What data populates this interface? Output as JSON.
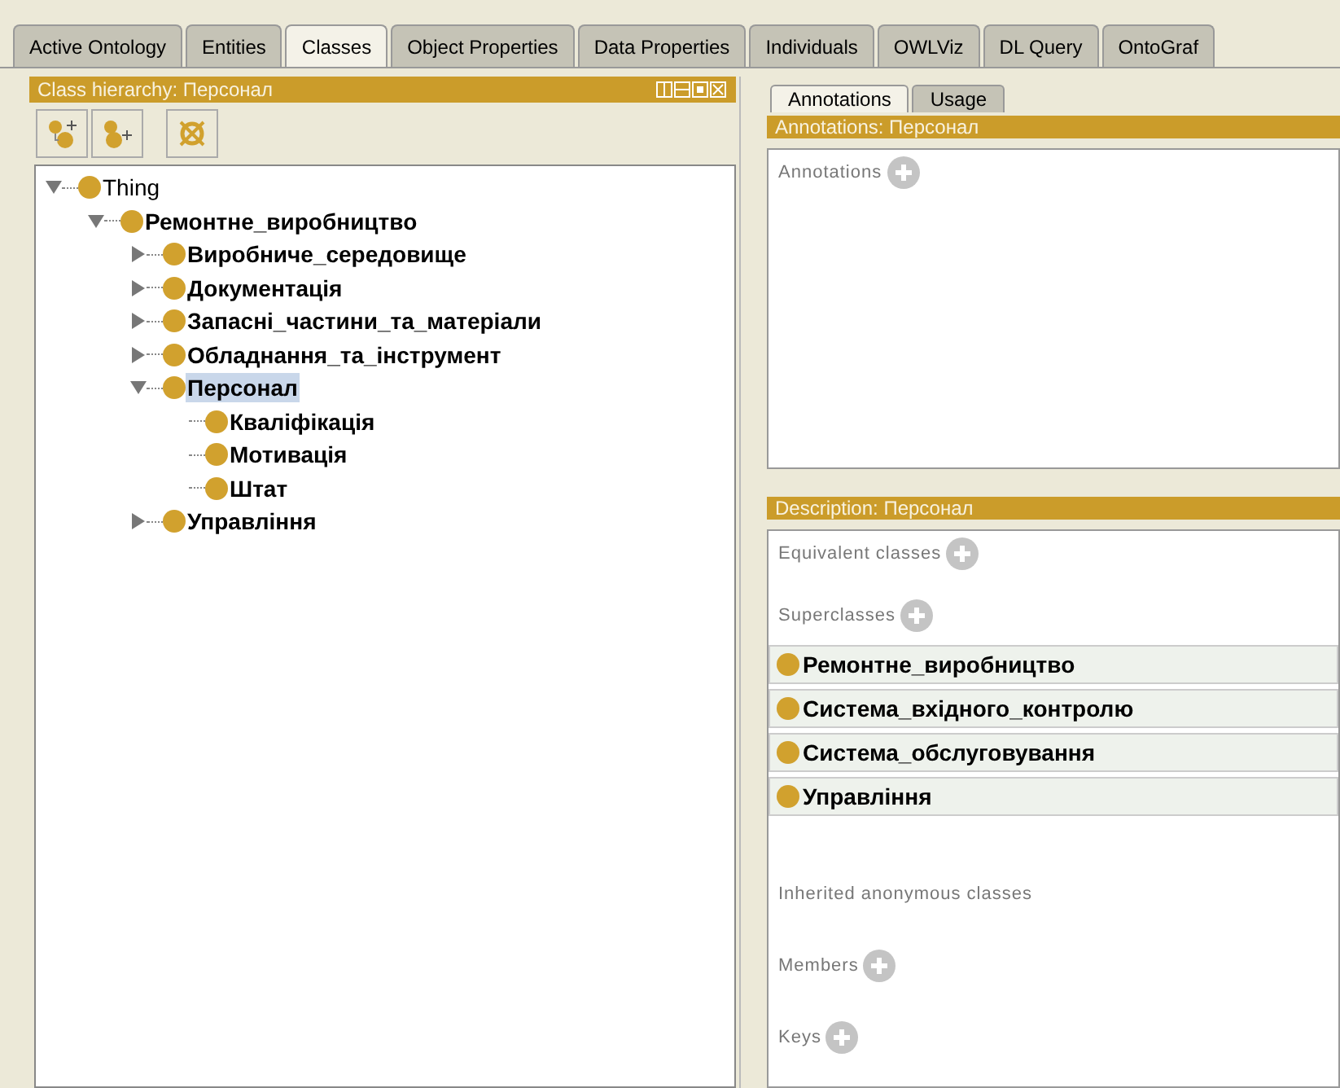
{
  "tabs": [
    {
      "label": "Active Ontology",
      "selected": false
    },
    {
      "label": "Entities",
      "selected": false
    },
    {
      "label": "Classes",
      "selected": true
    },
    {
      "label": "Object Properties",
      "selected": false
    },
    {
      "label": "Data Properties",
      "selected": false
    },
    {
      "label": "Individuals",
      "selected": false
    },
    {
      "label": "OWLViz",
      "selected": false
    },
    {
      "label": "DL Query",
      "selected": false
    },
    {
      "label": "OntoGraf",
      "selected": false
    }
  ],
  "class_hierarchy": {
    "title": "Class hierarchy: Персонал",
    "tree": [
      {
        "label": "Thing",
        "bold": false,
        "selected": false,
        "expanded": true,
        "children": [
          {
            "label": "Ремонтне_виробництво",
            "bold": true,
            "selected": false,
            "expanded": true,
            "children": [
              {
                "label": "Виробниче_середовище",
                "bold": true,
                "selected": false,
                "expanded": false
              },
              {
                "label": "Документація",
                "bold": true,
                "selected": false,
                "expanded": false
              },
              {
                "label": "Запасні_частини_та_матеріали",
                "bold": true,
                "selected": false,
                "expanded": false
              },
              {
                "label": "Обладнання_та_інструмент",
                "bold": true,
                "selected": false,
                "expanded": false
              },
              {
                "label": "Персонал",
                "bold": true,
                "selected": true,
                "expanded": true,
                "children": [
                  {
                    "label": "Кваліфікація",
                    "bold": true,
                    "selected": false
                  },
                  {
                    "label": "Мотивація",
                    "bold": true,
                    "selected": false
                  },
                  {
                    "label": "Штат",
                    "bold": true,
                    "selected": false
                  }
                ]
              },
              {
                "label": "Управління",
                "bold": true,
                "selected": false,
                "expanded": false
              }
            ]
          }
        ]
      }
    ]
  },
  "right_tabs": [
    {
      "label": "Annotations",
      "selected": true
    },
    {
      "label": "Usage",
      "selected": false
    }
  ],
  "annotations": {
    "title": "Annotations: Персонал",
    "section": "Annotations"
  },
  "description": {
    "title": "Description: Персонал",
    "sections": [
      {
        "label": "Equivalent classes",
        "add_button": true
      },
      {
        "label": "Superclasses",
        "add_button": true,
        "items": [
          "Ремонтне_виробництво",
          "Система_вхідного_контролю",
          "Система_обслуговування",
          "Управління"
        ]
      },
      {
        "label": "Inherited anonymous classes",
        "add_button": false
      },
      {
        "label": "Members",
        "add_button": true
      },
      {
        "label": "Keys",
        "add_button": true
      }
    ]
  }
}
